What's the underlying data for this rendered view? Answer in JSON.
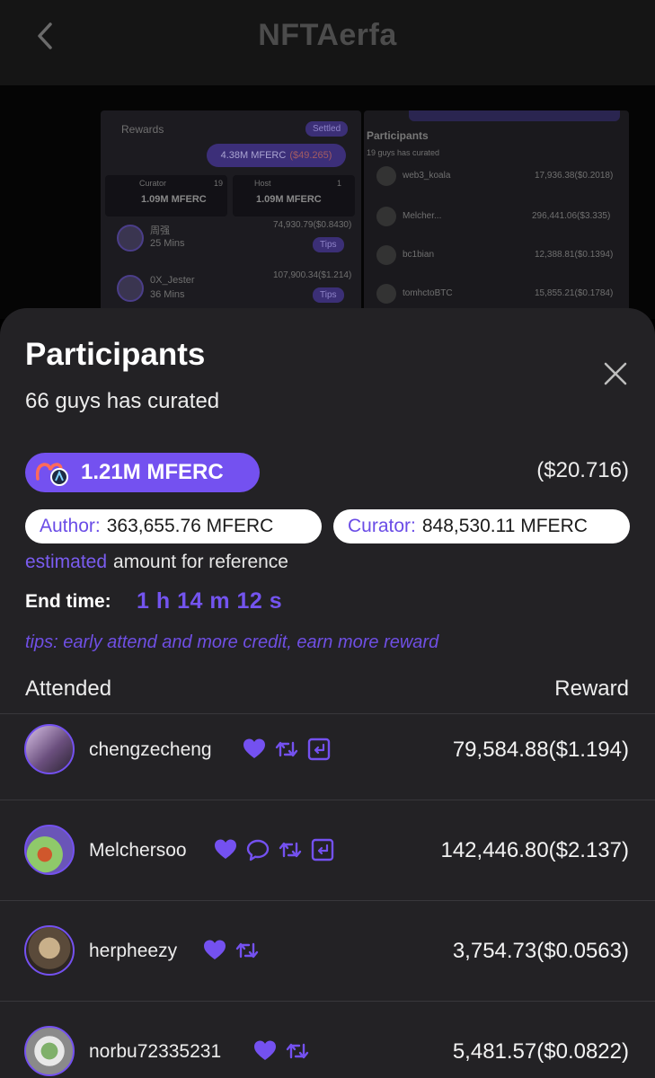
{
  "app": {
    "title": "NFTAerfa"
  },
  "preview": {
    "rewards_label": "Rewards",
    "settled_label": "Settled",
    "total": "4.38M MFERC",
    "total_usd": "($49.265)",
    "curator_label": "Curator",
    "curator_count": "19",
    "curator_amount": "1.09M MFERC",
    "host_label": "Host",
    "host_count": "1",
    "host_amount": "1.09M MFERC",
    "tips_label": "Tips",
    "left_rows": [
      {
        "name": "周强",
        "time": "25 Mins",
        "reward": "74,930.79($0.8430)"
      },
      {
        "name": "0X_Jester",
        "time": "36 Mins",
        "reward": "107,900.34($1.214)"
      }
    ],
    "participants_label": "Participants",
    "participants_sub": "19 guys has curated",
    "right_rows": [
      {
        "name": "web3_koala",
        "reward": "17,936.38($0.2018)"
      },
      {
        "name": "Melcher...",
        "reward": "296,441.06($3.335)"
      },
      {
        "name": "bc1bian",
        "reward": "12,388.81($0.1394)"
      },
      {
        "name": "tomhctoBTC",
        "reward": "15,855.21($0.1784)"
      }
    ]
  },
  "sheet": {
    "title": "Participants",
    "subtitle": "66 guys has curated",
    "total_amount": "1.21M MFERC",
    "total_usd": "($20.716)",
    "author_label": "Author:",
    "author_amount": "363,655.76 MFERC",
    "curator_label": "Curator:",
    "curator_amount": "848,530.11 MFERC",
    "estimated_highlight": "estimated",
    "estimated_rest": "amount for reference",
    "end_time_label": "End time:",
    "end_time_value": "1 h 14 m 12 s",
    "tips": "tips: early attend and more credit, earn more reward",
    "col_attended": "Attended",
    "col_reward": "Reward",
    "rows": [
      {
        "name": "chengzecheng",
        "icons": [
          "heart-icon",
          "retweet-icon",
          "quote-icon"
        ],
        "reward": "79,584.88($1.194)"
      },
      {
        "name": "Melchersoo",
        "icons": [
          "heart-icon",
          "comment-icon",
          "retweet-icon",
          "quote-icon"
        ],
        "reward": "142,446.80($2.137)"
      },
      {
        "name": "herpheezy",
        "icons": [
          "heart-icon",
          "retweet-icon"
        ],
        "reward": "3,754.73($0.0563)"
      },
      {
        "name": "norbu72335231",
        "icons": [
          "heart-icon",
          "retweet-icon"
        ],
        "reward": "5,481.57($0.0822)"
      }
    ]
  },
  "colors": {
    "accent": "#7451f0",
    "background": "#232225"
  }
}
